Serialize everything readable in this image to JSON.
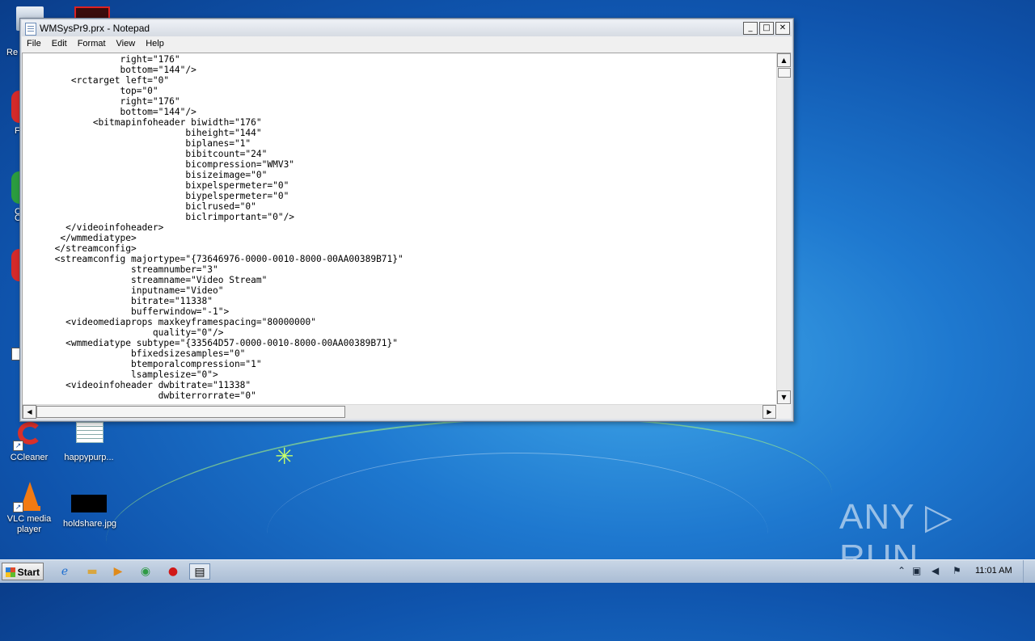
{
  "window": {
    "title": "WMSysPr9.prx - Notepad",
    "minimize": "_",
    "maximize": "□",
    "close": "✕"
  },
  "menu": [
    "File",
    "Edit",
    "Format",
    "View",
    "Help"
  ],
  "content": "                 right=\"176\"\n                 bottom=\"144\"/>\n        <rctarget left=\"0\"\n                 top=\"0\"\n                 right=\"176\"\n                 bottom=\"144\"/>\n            <bitmapinfoheader biwidth=\"176\"\n                             biheight=\"144\"\n                             biplanes=\"1\"\n                             bibitcount=\"24\"\n                             bicompression=\"WMV3\"\n                             bisizeimage=\"0\"\n                             bixpelspermeter=\"0\"\n                             biypelspermeter=\"0\"\n                             biclrused=\"0\"\n                             biclrimportant=\"0\"/>\n       </videoinfoheader>\n      </wmmediatype>\n     </streamconfig>\n     <streamconfig majortype=\"{73646976-0000-0010-8000-00AA00389B71}\"\n                   streamnumber=\"3\"\n                   streamname=\"Video Stream\"\n                   inputname=\"Video\"\n                   bitrate=\"11338\"\n                   bufferwindow=\"-1\">\n       <videomediaprops maxkeyframespacing=\"80000000\"\n                       quality=\"0\"/>\n       <wmmediatype subtype=\"{33564D57-0000-0010-8000-00AA00389B71}\"\n                   bfixedsizesamples=\"0\"\n                   btemporalcompression=\"1\"\n                   lsamplesize=\"0\">\n       <videoinfoheader dwbitrate=\"11338\"\n                        dwbiterrorrate=\"0\"",
  "desktop": {
    "icons": [
      {
        "label": "CCleaner"
      },
      {
        "label": "happypurp..."
      },
      {
        "label": "VLC media player"
      },
      {
        "label": "holdshare.jpg"
      }
    ],
    "partial_labels": [
      "Re",
      "F",
      "C",
      "C"
    ]
  },
  "watermark": "ANY ▷ RUN",
  "taskbar": {
    "start_label": "Start",
    "clock": "11:01 AM"
  }
}
